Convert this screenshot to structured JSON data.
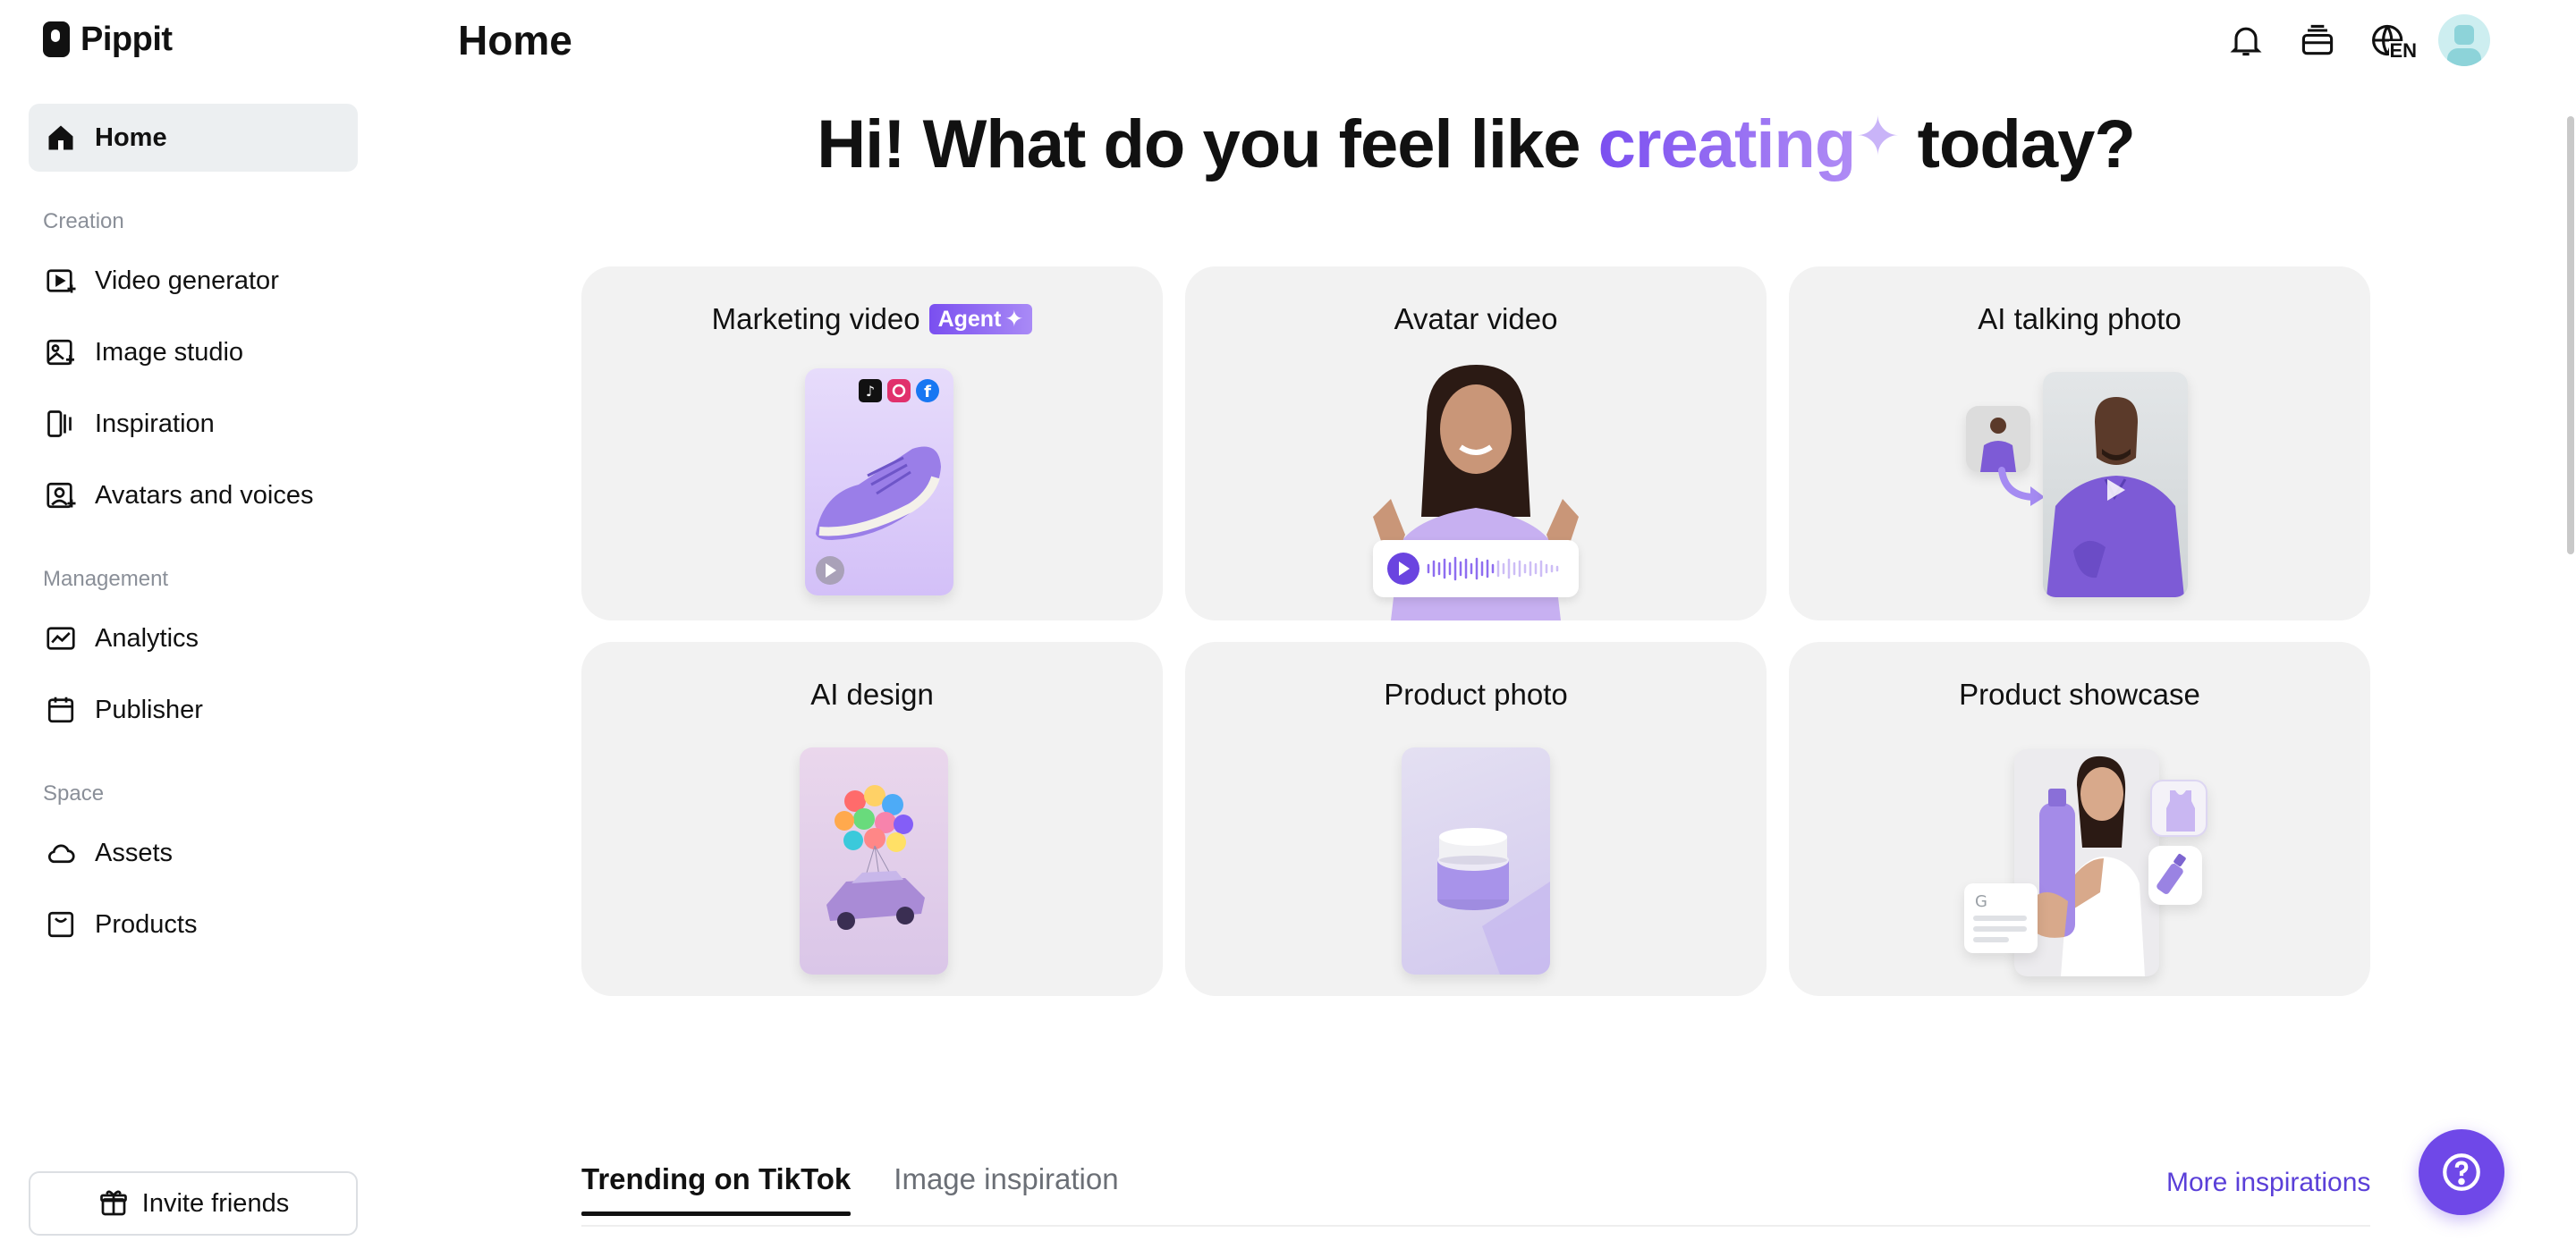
{
  "app": {
    "name": "Pippit"
  },
  "header": {
    "title": "Home",
    "lang": "EN"
  },
  "sidebar": {
    "home": "Home",
    "sections": {
      "creation": "Creation",
      "management": "Management",
      "space": "Space"
    },
    "creation_items": [
      {
        "label": "Video generator",
        "icon": "video-generator-icon"
      },
      {
        "label": "Image studio",
        "icon": "image-studio-icon"
      },
      {
        "label": "Inspiration",
        "icon": "inspiration-icon"
      },
      {
        "label": "Avatars and voices",
        "icon": "avatar-icon"
      }
    ],
    "management_items": [
      {
        "label": "Analytics",
        "icon": "analytics-icon"
      },
      {
        "label": "Publisher",
        "icon": "calendar-icon"
      }
    ],
    "space_items": [
      {
        "label": "Assets",
        "icon": "cloud-icon"
      },
      {
        "label": "Products",
        "icon": "bag-icon"
      }
    ],
    "invite": "Invite friends"
  },
  "hero": {
    "prefix": "Hi! What do you feel like ",
    "accent": "creating",
    "spark": "✦",
    "suffix": " today?"
  },
  "cards": [
    {
      "title": "Marketing video",
      "badge": "Agent"
    },
    {
      "title": "Avatar video"
    },
    {
      "title": "AI talking photo"
    },
    {
      "title": "AI design"
    },
    {
      "title": "Product photo"
    },
    {
      "title": "Product showcase"
    }
  ],
  "tabs": [
    {
      "label": "Trending on TikTok",
      "active": true
    },
    {
      "label": "Image inspiration",
      "active": false
    }
  ],
  "more_link": "More inspirations",
  "colors": {
    "accent": "#6f48e8",
    "card_bg": "#f2f2f2",
    "active_nav_bg": "#eceff1"
  }
}
